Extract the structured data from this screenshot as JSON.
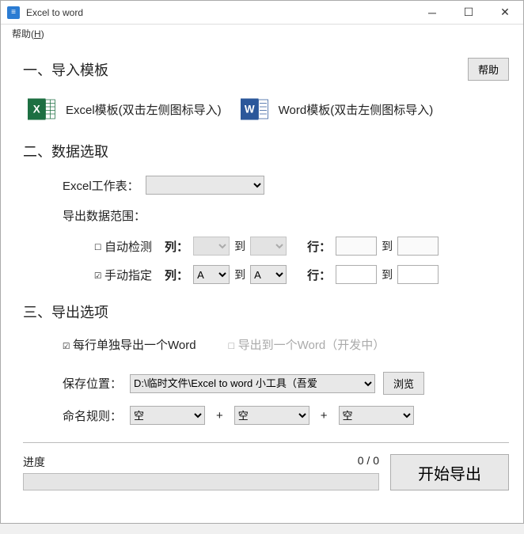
{
  "window": {
    "title": "Excel to word"
  },
  "menu": {
    "help": "帮助",
    "help_key": "H"
  },
  "section1": {
    "title": "一、导入模板",
    "help_btn": "帮助",
    "excel_label": "Excel模板(双击左侧图标导入)",
    "word_label": "Word模板(双击左侧图标导入)"
  },
  "section2": {
    "title": "二、数据选取",
    "worksheet_label": "Excel工作表：",
    "worksheet_value": "",
    "range_label": "导出数据范围：",
    "auto_detect": "自动检测",
    "manual_specify": "手动指定",
    "col_label": "列：",
    "row_label": "行：",
    "to": "到",
    "manual_col_from": "A",
    "manual_col_to": "A",
    "manual_row_from": "",
    "manual_row_to": ""
  },
  "section3": {
    "title": "三、导出选项",
    "each_row": "每行单独导出一个Word",
    "single_word": "导出到一个Word（开发中）",
    "save_loc_label": "保存位置：",
    "save_path": "D:\\临时文件\\Excel to word 小工具（吾爱",
    "browse": "浏览",
    "naming_label": "命名规则：",
    "empty_opt": "空",
    "plus": "+"
  },
  "footer": {
    "progress_label": "进度",
    "progress_text": "0 / 0",
    "start_export": "开始导出"
  }
}
